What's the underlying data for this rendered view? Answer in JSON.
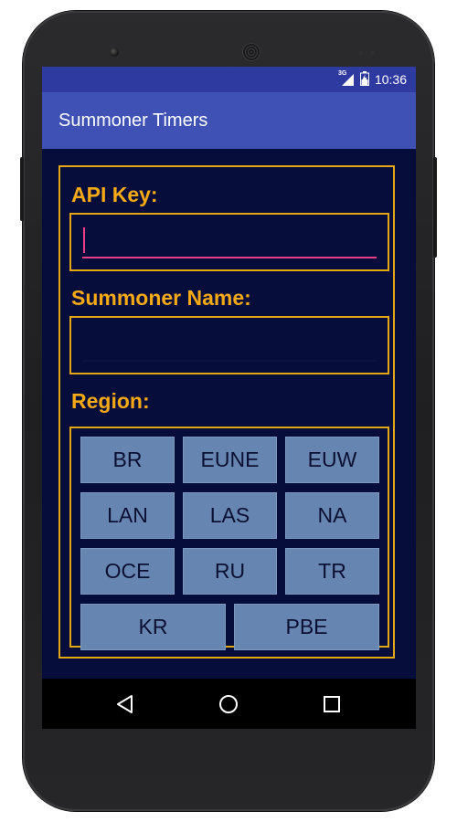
{
  "status_bar": {
    "network_label": "3G",
    "time": "10:36"
  },
  "app_bar": {
    "title": "Summoner Timers"
  },
  "form": {
    "api_key_label": "API Key:",
    "api_key_value": "",
    "summoner_name_label": "Summoner Name:",
    "summoner_name_value": "",
    "region_label": "Region:"
  },
  "regions": {
    "br": "BR",
    "eune": "EUNE",
    "euw": "EUW",
    "lan": "LAN",
    "las": "LAS",
    "na": "NA",
    "oce": "OCE",
    "ru": "RU",
    "tr": "TR",
    "kr": "KR",
    "pbe": "PBE"
  },
  "colors": {
    "app_bar": "#3f51b5",
    "status_bar": "#2f3aa1",
    "background": "#060d3b",
    "accent_gold": "#f4a915",
    "button_fill": "#6785b1",
    "focus_pink": "#e84088"
  },
  "icons": {
    "nav_back": "back-triangle-icon",
    "nav_home": "home-circle-icon",
    "nav_recents": "recents-square-icon",
    "signal": "signal-icon",
    "battery": "battery-icon"
  }
}
